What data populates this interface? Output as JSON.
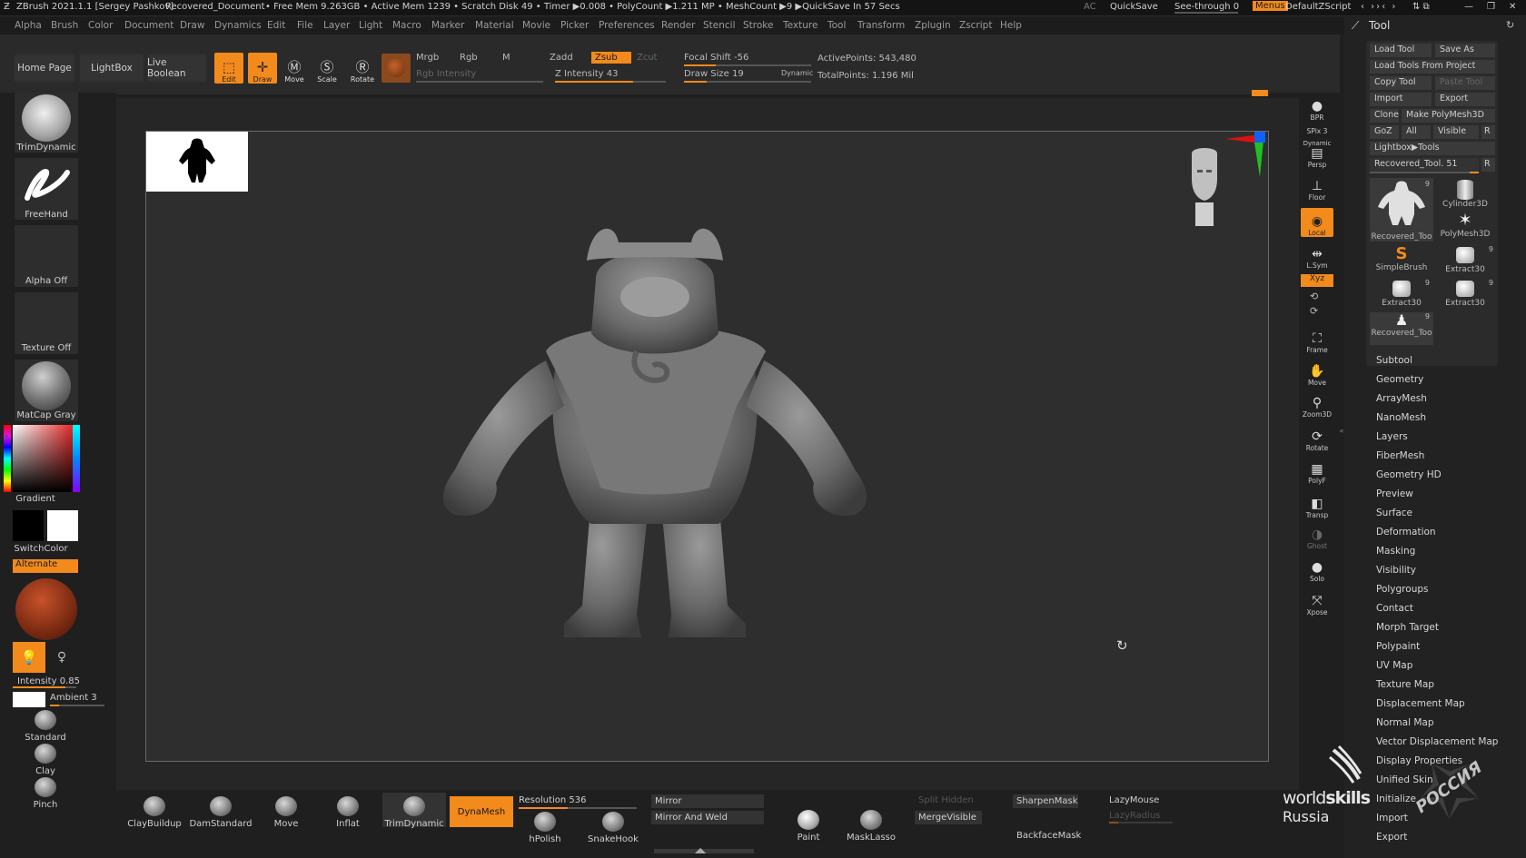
{
  "titlebar": {
    "app": "ZBrush 2021.1.1 [Sergey Pashkov]",
    "document": "Recovered_Document",
    "stats": "• Free Mem 9.263GB • Active Mem 1239 • Scratch Disk 49 • Timer ▶0.008 • PolyCount ▶1.211 MP • MeshCount ▶9 ▶QuickSave In 57 Secs",
    "ac": "AC",
    "quicksave": "QuickSave",
    "seethrough": "See-through  0",
    "menus": "Menus",
    "zscript": "DefaultZScript"
  },
  "menu": [
    "Alpha",
    "Brush",
    "Color",
    "Document",
    "Draw",
    "Dynamics",
    "Edit",
    "File",
    "Layer",
    "Light",
    "Macro",
    "Marker",
    "Material",
    "Movie",
    "Picker",
    "Preferences",
    "Render",
    "Stencil",
    "Stroke",
    "Texture",
    "Tool",
    "Transform",
    "Zplugin",
    "Zscript",
    "Help"
  ],
  "toolbar": {
    "home": "Home Page",
    "lightbox": "LightBox",
    "boolean": "Live Boolean",
    "edit": "Edit",
    "draw": "Draw",
    "move": "Move",
    "scale": "Scale",
    "rotate": "Rotate",
    "mrgb": "Mrgb",
    "rgb": "Rgb",
    "m": "M",
    "rgb_intensity": "Rgb Intensity",
    "zadd": "Zadd",
    "zsub": "Zsub",
    "zcut": "Zcut",
    "z_intensity": "Z Intensity 43",
    "focal": "Focal Shift -56",
    "draw_size": "Draw Size 19",
    "dynamic": "Dynamic",
    "active_points": "ActivePoints: 543,480",
    "total_points": "TotalPoints: 1.196 Mil"
  },
  "left": {
    "brush": "TrimDynamic",
    "stroke": "FreeHand",
    "alpha": "Alpha Off",
    "texture": "Texture Off",
    "material": "MatCap Gray",
    "gradient": "Gradient",
    "switch": "SwitchColor",
    "alternate": "Alternate",
    "intensity": "Intensity 0.85",
    "ambient": "Ambient 3",
    "brushes": [
      "Standard",
      "Clay",
      "Pinch"
    ]
  },
  "right_tools": [
    "BPR",
    "SPix 3",
    "Persp",
    "Floor",
    "Local",
    "L.Sym",
    "Frame",
    "Move",
    "Zoom3D",
    "Rotate",
    "PolyF",
    "Transp",
    "Ghost",
    "Solo",
    "Xpose"
  ],
  "xyz": "Xyz",
  "dynamic_label": "Dynamic",
  "tool_panel": {
    "title": "Tool",
    "load_tool": "Load Tool",
    "save_as": "Save As",
    "load_from_project": "Load Tools From Project",
    "copy_tool": "Copy Tool",
    "paste_tool": "Paste Tool",
    "import": "Import",
    "export": "Export",
    "clone": "Clone",
    "make_polymesh": "Make PolyMesh3D",
    "goz": "GoZ",
    "all": "All",
    "visible": "Visible",
    "r": "R",
    "lightbox_tools": "Lightbox▶Tools",
    "current_tool": "Recovered_Tool. 51",
    "thumbs": [
      {
        "label": "Recovered_Too",
        "count": "9"
      },
      {
        "label": "Cylinder3D",
        "count": ""
      },
      {
        "label": "PolyMesh3D",
        "count": ""
      },
      {
        "label": "SimpleBrush",
        "count": ""
      },
      {
        "label": "Extract30",
        "count": "9"
      },
      {
        "label": "Extract30",
        "count": "9"
      },
      {
        "label": "Extract30",
        "count": "9"
      },
      {
        "label": "Recovered_Too",
        "count": "9"
      }
    ],
    "sections": [
      "Subtool",
      "Geometry",
      "ArrayMesh",
      "NanoMesh",
      "Layers",
      "FiberMesh",
      "Geometry HD",
      "Preview",
      "Surface",
      "Deformation",
      "Masking",
      "Visibility",
      "Polygroups",
      "Contact",
      "Morph Target",
      "Polypaint",
      "UV Map",
      "Texture Map",
      "Displacement Map",
      "Normal Map",
      "Vector Displacement Map",
      "Display Properties",
      "Unified Skin",
      "Initialize",
      "Import",
      "Export"
    ]
  },
  "bottom": {
    "brushes": [
      "ClayBuildup",
      "DamStandard",
      "Move",
      "Inflat",
      "TrimDynamic"
    ],
    "dynamesh": "DynaMesh",
    "resolution": "Resolution 536",
    "mirror": "Mirror",
    "mirror_weld": "Mirror And Weld",
    "hpolish": "hPolish",
    "snakehook": "SnakeHook",
    "paint": "Paint",
    "masklasso": "MaskLasso",
    "split_hidden": "Split Hidden",
    "merge_visible": "MergeVisible",
    "sharpen_mask": "SharpenMask",
    "backface_mask": "BackfaceMask",
    "lazymouse": "LazyMouse",
    "lazyradius": "LazyRadius"
  },
  "watermark": {
    "line1": "world",
    "bold": "skills",
    "line2": "Russia",
    "seal": "РОССИЯ"
  },
  "colors": {
    "accent": "#f28a1c",
    "panel": "#2a2a2a",
    "background": "#1f1f1f"
  }
}
